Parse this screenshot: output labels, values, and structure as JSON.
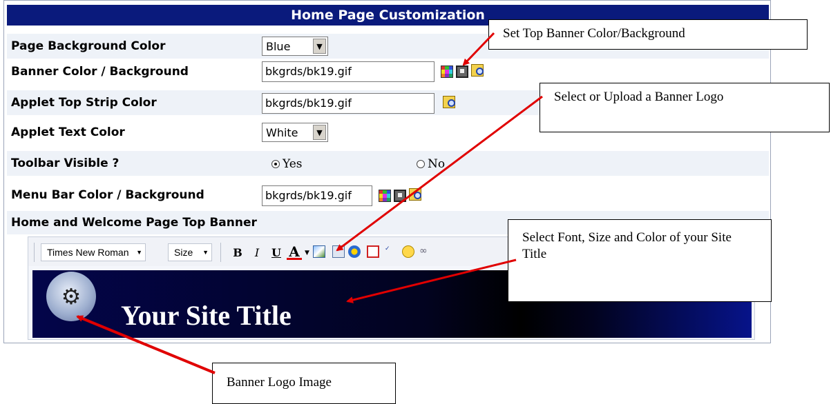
{
  "panel": {
    "title": "Home Page Customization",
    "rows": [
      {
        "label": "Page Background Color",
        "select_value": "Blue"
      },
      {
        "label": "Banner Color / Background",
        "input_value": "bkgrds/bk19.gif"
      },
      {
        "label": "Applet Top Strip Color",
        "input_value": "bkgrds/bk19.gif"
      },
      {
        "label": "Applet Text Color",
        "select_value": "White"
      },
      {
        "label": "Toolbar Visible ?",
        "radio_yes": "Yes",
        "radio_no": "No",
        "selected": "Yes"
      },
      {
        "label": "Menu Bar Color / Background",
        "input_value": "bkgrds/bk19.gif"
      }
    ],
    "section_label": "Home and Welcome Page Top Banner"
  },
  "editor": {
    "font_dropdown": "Times New Roman",
    "size_dropdown": "Size",
    "bold": "B",
    "italic": "I",
    "underline": "U",
    "font_color": "A",
    "site_title": "Your Site Title"
  },
  "callouts": {
    "banner_color": "Set Top Banner Color/Background",
    "banner_logo": "Select or Upload a Banner Logo",
    "font": "Select Font, Size and Color of your Site Title",
    "logo_image": "Banner Logo Image"
  },
  "colors": {
    "title_bar": "#0a1a7c",
    "arrow": "#e00000"
  }
}
